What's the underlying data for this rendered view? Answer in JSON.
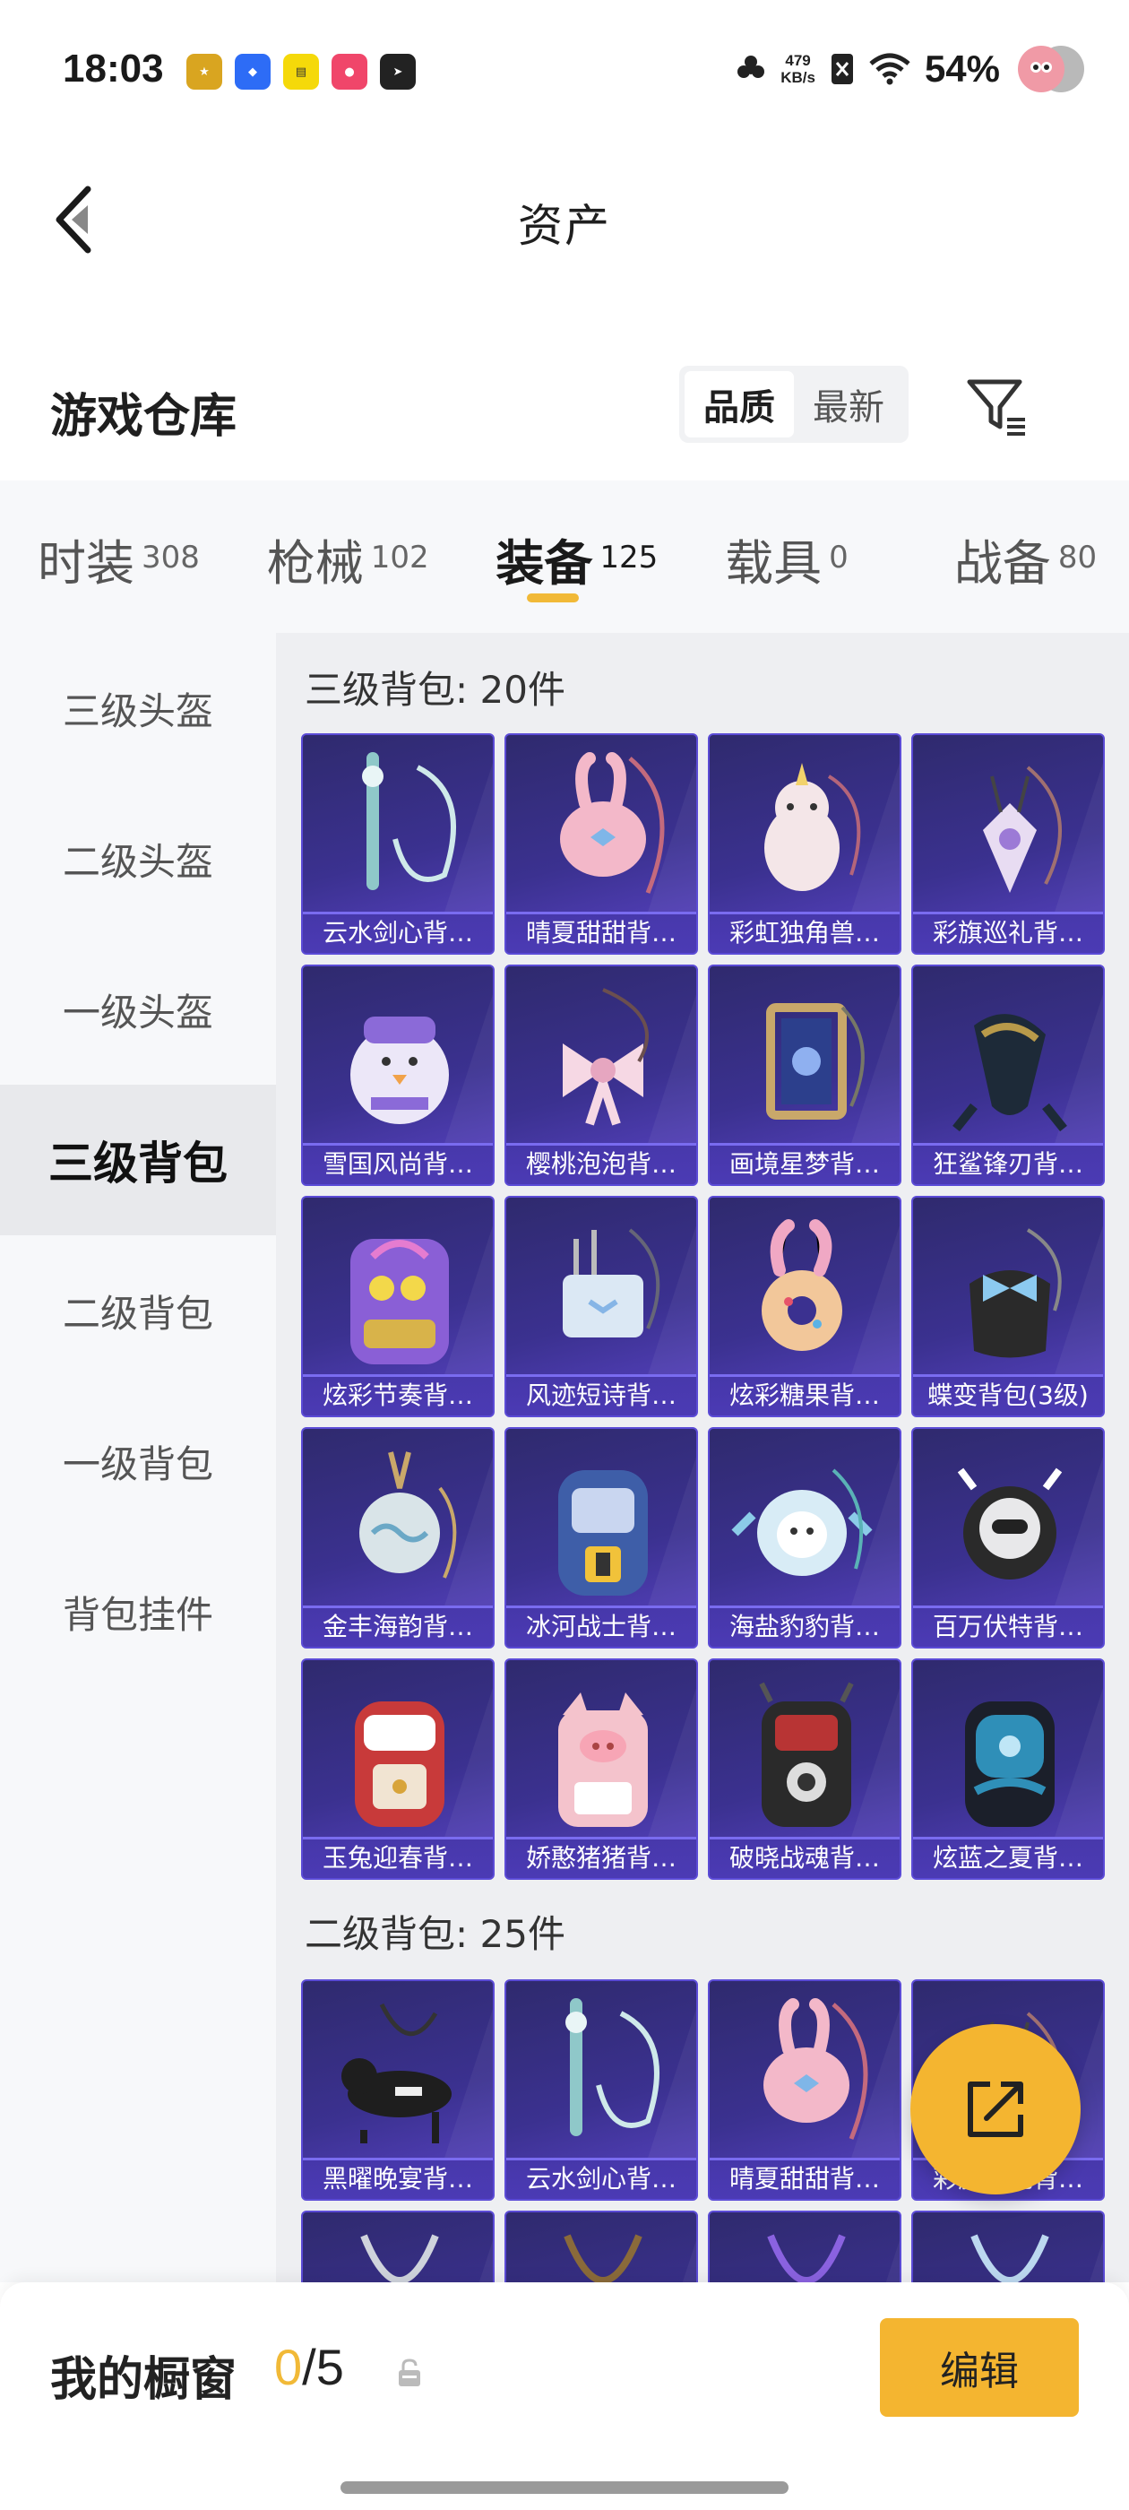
{
  "status_bar": {
    "time": "18:03",
    "net_speed_value": "479",
    "net_speed_unit": "KB/s",
    "battery": "54%"
  },
  "header": {
    "title": "资产"
  },
  "warehouse": {
    "title": "游戏仓库",
    "sort_options": [
      "品质",
      "最新"
    ],
    "active_sort": "品质"
  },
  "tabs": [
    {
      "label": "时装",
      "count": "308"
    },
    {
      "label": "枪械",
      "count": "102"
    },
    {
      "label": "装备",
      "count": "125"
    },
    {
      "label": "载具",
      "count": "0"
    },
    {
      "label": "战备",
      "count": "80"
    }
  ],
  "active_tab": "装备",
  "sidebar": {
    "items": [
      "三级头盔",
      "二级头盔",
      "一级头盔",
      "三级背包",
      "二级背包",
      "一级背包",
      "背包挂件"
    ],
    "active": "三级背包"
  },
  "sections": [
    {
      "title": "三级背包: 20件",
      "items": [
        {
          "name": "云水剑心背…",
          "art": "sword-bag",
          "color": "#8fc8c9"
        },
        {
          "name": "晴夏甜甜背…",
          "art": "shell-bag",
          "color": "#f3b8c9"
        },
        {
          "name": "彩虹独角兽…",
          "art": "unicorn-bag",
          "color": "#f4e6e8"
        },
        {
          "name": "彩旗巡礼背…",
          "art": "star-bag",
          "color": "#e8dcf2"
        },
        {
          "name": "雪国风尚背…",
          "art": "penguin-bag",
          "color": "#ece7f8"
        },
        {
          "name": "樱桃泡泡背…",
          "art": "bow-bag",
          "color": "#f6d8e4"
        },
        {
          "name": "画境星梦背…",
          "art": "frame-bag",
          "color": "#c9a86a"
        },
        {
          "name": "狂鲨锋刃背…",
          "art": "shark-bag",
          "color": "#b89a4a"
        },
        {
          "name": "炫彩节奏背…",
          "art": "graffiti-bag",
          "color": "#8a5fd6"
        },
        {
          "name": "风迹短诗背…",
          "art": "box-bag",
          "color": "#dbe8f4"
        },
        {
          "name": "炫彩糖果背…",
          "art": "donut-bag",
          "color": "#f2c79a"
        },
        {
          "name": "蝶变背包(3级)",
          "art": "butterfly-bag",
          "color": "#2a2a2a"
        },
        {
          "name": "金丰海韵背…",
          "art": "wave-bag",
          "color": "#d9e4e8"
        },
        {
          "name": "冰河战士背…",
          "art": "blue-backpack",
          "color": "#3e5ea8"
        },
        {
          "name": "海盐豹豹背…",
          "art": "seal-bag",
          "color": "#d8ecf6"
        },
        {
          "name": "百万伏特背…",
          "art": "robot-bag",
          "color": "#e8e8ea"
        },
        {
          "name": "玉兔迎春背…",
          "art": "red-backpack",
          "color": "#c83a3a"
        },
        {
          "name": "娇憨猪猪背…",
          "art": "pig-backpack",
          "color": "#f4c3cc"
        },
        {
          "name": "破晓战魂背…",
          "art": "armor-backpack",
          "color": "#b83434"
        },
        {
          "name": "炫蓝之夏背…",
          "art": "ocean-backpack",
          "color": "#2f8fb8"
        }
      ]
    },
    {
      "title": "二级背包: 25件",
      "items": [
        {
          "name": "黑曜晚宴背…",
          "art": "dog-bag",
          "color": "#1e1e1e"
        },
        {
          "name": "云水剑心背…",
          "art": "sword-bag",
          "color": "#8fc8c9"
        },
        {
          "name": "晴夏甜甜背…",
          "art": "shell-bag",
          "color": "#f3b8c9"
        },
        {
          "name": "彩旗巡礼背…",
          "art": "star-bag",
          "color": "#e8dcf2"
        },
        {
          "name": "",
          "art": "strap-bag",
          "color": "#cfd3dc"
        },
        {
          "name": "",
          "art": "strap-bag",
          "color": "#8a6a3a"
        },
        {
          "name": "",
          "art": "strap-bag",
          "color": "#8a62e0"
        },
        {
          "name": "",
          "art": "strap-bag",
          "color": "#bcd8f0"
        }
      ]
    }
  ],
  "bottom": {
    "window_label": "我的橱窗",
    "window_current": "0",
    "window_total": "/5",
    "edit_label": "编辑"
  },
  "colors": {
    "accent": "#f4b530",
    "card_bg": "#3b3190",
    "card_border": "#5b4bd6"
  }
}
